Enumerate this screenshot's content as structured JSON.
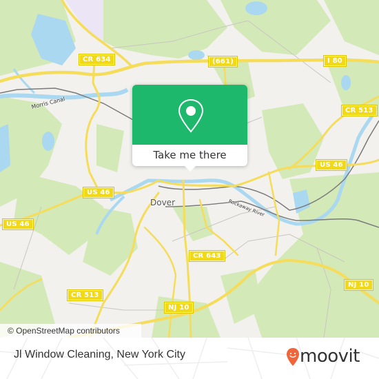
{
  "map": {
    "place_labels": {
      "dover": "Dover"
    },
    "waterway_labels": {
      "morris_canal": "Morris Canal",
      "rockaway_river": "Rockaway River"
    },
    "road_shields": [
      {
        "id": "cr634",
        "label": "CR 634"
      },
      {
        "id": "661",
        "label": "(661)"
      },
      {
        "id": "i80",
        "label": "I 80"
      },
      {
        "id": "cr513-ne",
        "label": "CR 513"
      },
      {
        "id": "us46-e",
        "label": "US 46"
      },
      {
        "id": "us46-c",
        "label": "US 46"
      },
      {
        "id": "us46-w",
        "label": "US 46"
      },
      {
        "id": "cr643",
        "label": "CR 643"
      },
      {
        "id": "cr513-sw",
        "label": "CR 513"
      },
      {
        "id": "nj10-c",
        "label": "NJ 10"
      },
      {
        "id": "nj10-e",
        "label": "NJ 10"
      }
    ],
    "attribution": "© OpenStreetMap contributors",
    "colors": {
      "land": "#f2f1ee",
      "forest": "#cfe6b0",
      "water": "#a9d8f0",
      "highway": "#f5dc5a",
      "rail": "#777777",
      "marker_green": "#1eb86c"
    }
  },
  "popup": {
    "icon": "location-pin-icon",
    "action_label": "Take me there"
  },
  "footer": {
    "title": "Jl Window Cleaning, New York City",
    "brand": "moovit",
    "brand_color": "#f0653a"
  }
}
